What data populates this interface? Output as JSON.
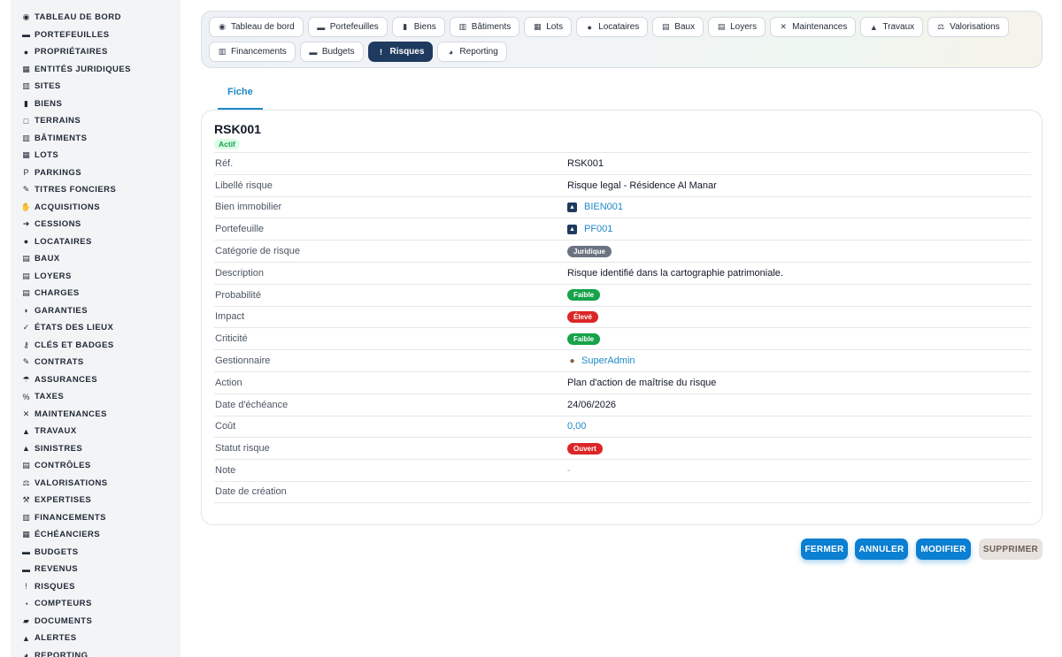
{
  "sidebar": {
    "items": [
      {
        "label": "Tableau de bord",
        "icon": "dashboard-icon",
        "glyph": "◉"
      },
      {
        "label": "Portefeuilles",
        "icon": "briefcase-icon",
        "glyph": "▬"
      },
      {
        "label": "Propriétaires",
        "icon": "user-icon",
        "glyph": "●"
      },
      {
        "label": "Entités juridiques",
        "icon": "building-icon",
        "glyph": "▦"
      },
      {
        "label": "Sites",
        "icon": "city-icon",
        "glyph": "▥"
      },
      {
        "label": "Biens",
        "icon": "building-icon",
        "glyph": "▮"
      },
      {
        "label": "Terrains",
        "icon": "vector-square-icon",
        "glyph": "□"
      },
      {
        "label": "Bâtiments",
        "icon": "city-icon",
        "glyph": "▥"
      },
      {
        "label": "Lots",
        "icon": "grid-icon",
        "glyph": "▦"
      },
      {
        "label": "Parkings",
        "icon": "parking-icon",
        "glyph": "P"
      },
      {
        "label": "Titres fonciers",
        "icon": "file-signature-icon",
        "glyph": "✎"
      },
      {
        "label": "Acquisitions",
        "icon": "handshake-icon",
        "glyph": "✋"
      },
      {
        "label": "Cessions",
        "icon": "sign-out-icon",
        "glyph": "➜"
      },
      {
        "label": "Locataires",
        "icon": "users-icon",
        "glyph": "●"
      },
      {
        "label": "Baux",
        "icon": "file-contract-icon",
        "glyph": "▤"
      },
      {
        "label": "Loyers",
        "icon": "receipt-icon",
        "glyph": "▤"
      },
      {
        "label": "Charges",
        "icon": "file-invoice-icon",
        "glyph": "▤"
      },
      {
        "label": "Garanties",
        "icon": "shield-icon",
        "glyph": "◗"
      },
      {
        "label": "États des lieux",
        "icon": "clipboard-check-icon",
        "glyph": "✓"
      },
      {
        "label": "Clés et badges",
        "icon": "key-icon",
        "glyph": "⚷"
      },
      {
        "label": "Contrats",
        "icon": "file-signature-icon",
        "glyph": "✎"
      },
      {
        "label": "Assurances",
        "icon": "umbrella-icon",
        "glyph": "☂"
      },
      {
        "label": "Taxes",
        "icon": "percent-icon",
        "glyph": "%"
      },
      {
        "label": "Maintenances",
        "icon": "tools-icon",
        "glyph": "✕"
      },
      {
        "label": "Travaux",
        "icon": "hard-hat-icon",
        "glyph": "▲"
      },
      {
        "label": "Sinistres",
        "icon": "warning-icon",
        "glyph": "▲"
      },
      {
        "label": "Contrôles",
        "icon": "clipboard-icon",
        "glyph": "▤"
      },
      {
        "label": "Valorisations",
        "icon": "balance-scale-icon",
        "glyph": "⚖"
      },
      {
        "label": "Expertises",
        "icon": "gavel-icon",
        "glyph": "⚒"
      },
      {
        "label": "Financements",
        "icon": "bank-icon",
        "glyph": "▥"
      },
      {
        "label": "Échéanciers",
        "icon": "calendar-icon",
        "glyph": "▦"
      },
      {
        "label": "Budgets",
        "icon": "wallet-icon",
        "glyph": "▬"
      },
      {
        "label": "Revenus",
        "icon": "money-bill-icon",
        "glyph": "▬"
      },
      {
        "label": "Risques",
        "icon": "exclamation-circle-icon",
        "glyph": "!"
      },
      {
        "label": "Compteurs",
        "icon": "gauge-icon",
        "glyph": "◔"
      },
      {
        "label": "Documents",
        "icon": "folder-open-icon",
        "glyph": "▰"
      },
      {
        "label": "Alertes",
        "icon": "bell-icon",
        "glyph": "▲"
      },
      {
        "label": "Reporting",
        "icon": "chart-pie-icon",
        "glyph": "◕"
      }
    ]
  },
  "modules": {
    "row1": [
      {
        "label": "Tableau de bord",
        "icon": "dashboard-icon",
        "glyph": "◉"
      },
      {
        "label": "Portefeuilles",
        "icon": "briefcase-icon",
        "glyph": "▬"
      },
      {
        "label": "Biens",
        "icon": "building-icon",
        "glyph": "▮"
      },
      {
        "label": "Bâtiments",
        "icon": "city-icon",
        "glyph": "▥"
      },
      {
        "label": "Lots",
        "icon": "grid-icon",
        "glyph": "▦"
      },
      {
        "label": "Locataires",
        "icon": "users-icon",
        "glyph": "●"
      },
      {
        "label": "Baux",
        "icon": "file-contract-icon",
        "glyph": "▤"
      },
      {
        "label": "Loyers",
        "icon": "receipt-icon",
        "glyph": "▤"
      },
      {
        "label": "Maintenances",
        "icon": "tools-icon",
        "glyph": "✕"
      },
      {
        "label": "Travaux",
        "icon": "hard-hat-icon",
        "glyph": "▲"
      },
      {
        "label": "Valorisations",
        "icon": "balance-scale-icon",
        "glyph": "⚖"
      }
    ],
    "row2": [
      {
        "label": "Financements",
        "icon": "bank-icon",
        "glyph": "▥"
      },
      {
        "label": "Budgets",
        "icon": "wallet-icon",
        "glyph": "▬"
      },
      {
        "label": "Risques",
        "icon": "exclamation-circle-icon",
        "glyph": "!",
        "active": true
      },
      {
        "label": "Reporting",
        "icon": "chart-pie-icon",
        "glyph": "◕"
      }
    ]
  },
  "tabs": [
    {
      "label": "Fiche"
    }
  ],
  "record": {
    "title": "RSK001",
    "status": "Actif",
    "fields": {
      "ref": {
        "label": "Réf.",
        "value": "RSK001"
      },
      "libelle": {
        "label": "Libellé risque",
        "value": "Risque legal - Résidence Al Manar"
      },
      "bien": {
        "label": "Bien immobilier",
        "value": "BIEN001",
        "icon": "building-icon"
      },
      "portefeuille": {
        "label": "Portefeuille",
        "value": "PF001",
        "icon": "building-icon"
      },
      "categorie": {
        "label": "Catégorie de risque",
        "value": "Juridique",
        "color": "#6b7280"
      },
      "description": {
        "label": "Description",
        "value": "Risque identifié dans la cartographie patrimoniale."
      },
      "probabilite": {
        "label": "Probabilité",
        "value": "Faible",
        "color": "#16a34a"
      },
      "impact": {
        "label": "Impact",
        "value": "Élevé",
        "color": "#dc2626"
      },
      "criticite": {
        "label": "Criticité",
        "value": "Faible",
        "color": "#16a34a"
      },
      "gestionnaire": {
        "label": "Gestionnaire",
        "value": "SuperAdmin",
        "icon": "user-icon"
      },
      "action": {
        "label": "Action",
        "value": "Plan d'action de maîtrise du risque"
      },
      "echeance": {
        "label": "Date d'échéance",
        "value": "24/06/2026"
      },
      "cout": {
        "label": "Coût",
        "value": "0,00"
      },
      "statut": {
        "label": "Statut risque",
        "value": "Ouvert",
        "color": "#dc2626"
      },
      "note": {
        "label": "Note",
        "value": "-"
      },
      "creation": {
        "label": "Date de création",
        "value": ""
      }
    }
  },
  "actions": {
    "fermer": "Fermer",
    "annuler": "Annuler",
    "modifier": "Modifier",
    "supprimer": "Supprimer"
  },
  "colors": {
    "accent": "#1e88c7",
    "active_module": "#1f3a5f",
    "primary_button": "#0b7fd1"
  }
}
